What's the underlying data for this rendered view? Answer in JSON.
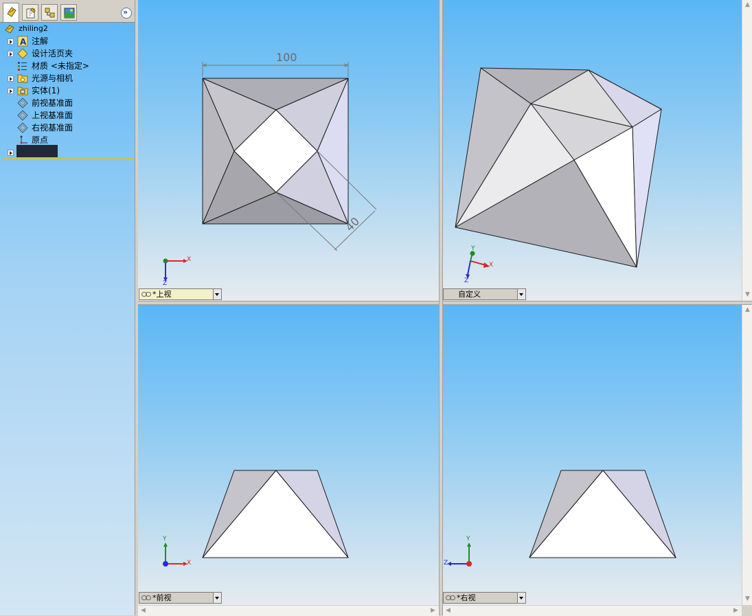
{
  "feature_tree": {
    "root": {
      "label": "zhiling2",
      "icon": "part-icon"
    },
    "items": [
      {
        "label": "注解",
        "icon": "annotations-icon",
        "expandable": true
      },
      {
        "label": "设计活页夹",
        "icon": "design-binder-icon",
        "expandable": true
      },
      {
        "label": "材质 <未指定>",
        "icon": "material-icon",
        "expandable": false
      },
      {
        "label": "光源与相机",
        "icon": "lights-cameras-icon",
        "expandable": true
      },
      {
        "label": "实体(1)",
        "icon": "solid-bodies-icon",
        "expandable": true
      },
      {
        "label": "前视基准面",
        "icon": "plane-icon",
        "expandable": false
      },
      {
        "label": "上视基准面",
        "icon": "plane-icon",
        "expandable": false
      },
      {
        "label": "右视基准面",
        "icon": "plane-icon",
        "expandable": false
      },
      {
        "label": "原点",
        "icon": "origin-icon",
        "expandable": false
      }
    ]
  },
  "panel_tabs": [
    "feature-manager-tab",
    "property-manager-tab",
    "configuration-manager-tab",
    "display-manager-tab"
  ],
  "viewports": {
    "top_left": {
      "view_label": "*上视",
      "dimension_width": "100",
      "dimension_depth": "40"
    },
    "top_right": {
      "view_label": "自定义"
    },
    "bottom_left": {
      "view_label": "*前视"
    },
    "bottom_right": {
      "view_label": "*右视"
    }
  },
  "triad": {
    "x": "X",
    "y": "Y",
    "z": "Z"
  },
  "colors": {
    "viewport_top": "#5ab6f6",
    "viewport_bottom": "#e6ebef",
    "x_axis": "#d42a2a",
    "y_axis": "#1f8a2a",
    "z_axis": "#2a2ad4",
    "tree_separator": "#e6c200"
  }
}
